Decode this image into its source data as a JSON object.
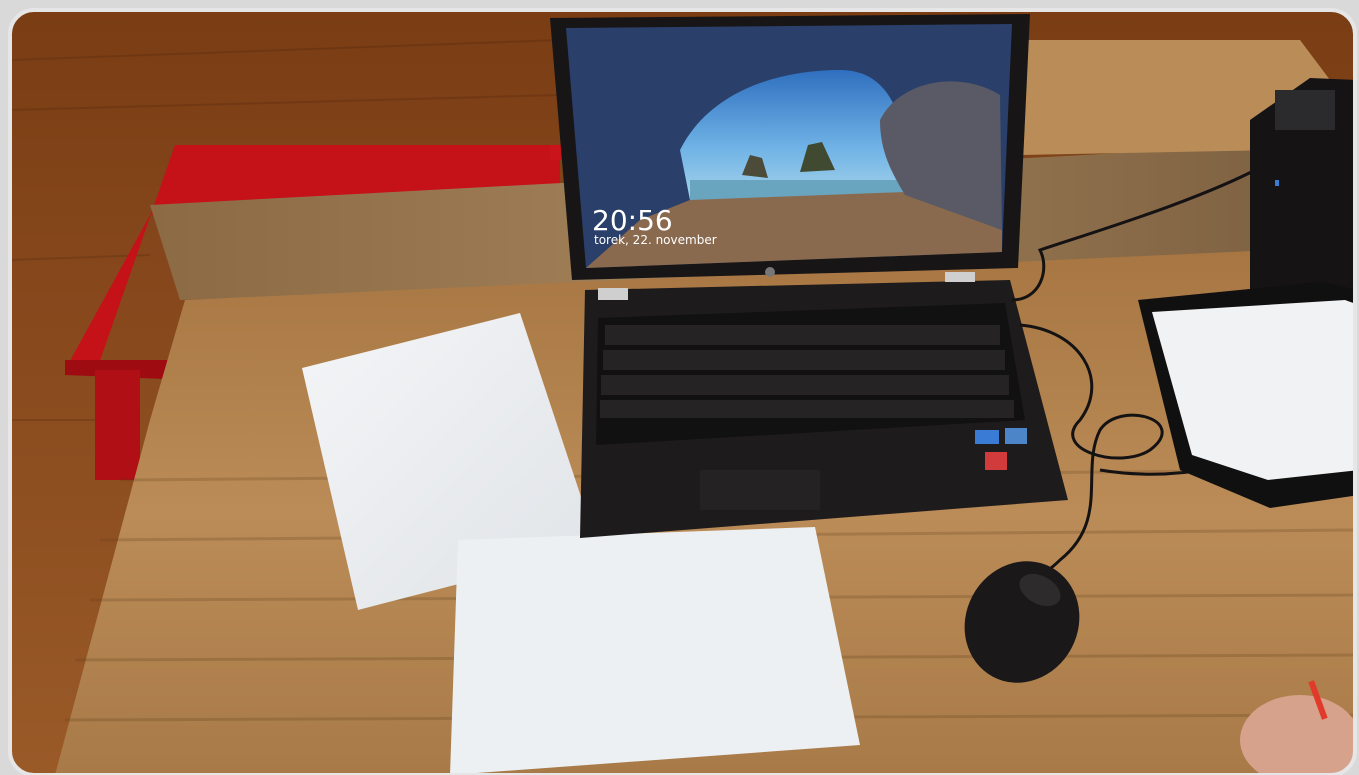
{
  "photo": {
    "description_free": true,
    "lock_screen": {
      "time": "20:56",
      "date": "torek, 22. november"
    },
    "brand_icon": "hp-logo-icon",
    "colors": {
      "wall_wood": "#8a4a1c",
      "desk_wood": "#b8874f",
      "bench_red": "#c8141a",
      "laptop_body": "#1c1a1b",
      "screen_sky": "#3d7fc4",
      "paper": "#eef0f2",
      "frame": "#d9d9d9"
    }
  }
}
